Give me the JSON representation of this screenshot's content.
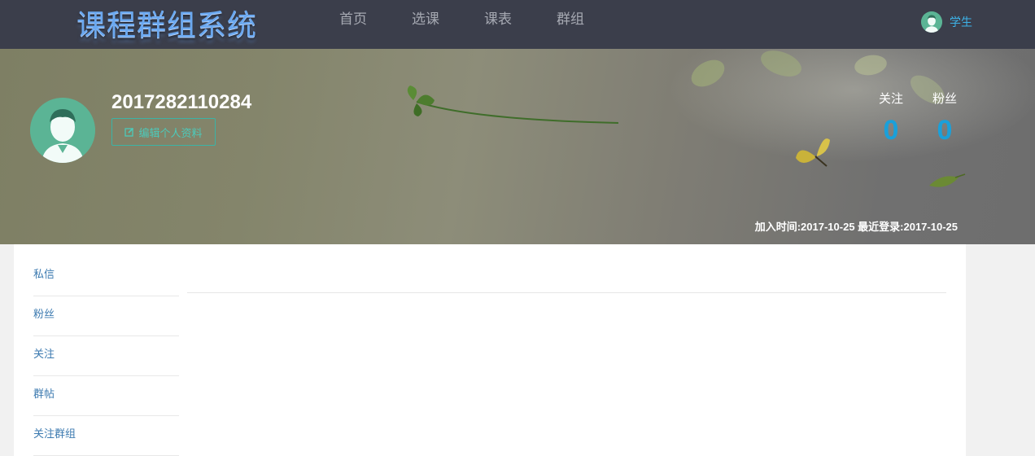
{
  "header": {
    "logo": "课程群组系统",
    "nav": [
      "首页",
      "选课",
      "课表",
      "群组"
    ],
    "user_label": "学生"
  },
  "profile": {
    "student_id": "2017282110284",
    "edit_button": "编辑个人资料",
    "following_label": "关注",
    "following_count": "0",
    "followers_label": "粉丝",
    "followers_count": "0",
    "dates": "加入时间:2017-10-25 最近登录:2017-10-25"
  },
  "sidebar": {
    "items": [
      "私信",
      "粉丝",
      "关注",
      "群帖",
      "关注群组"
    ]
  },
  "colors": {
    "topbar": "#3b3e4b",
    "accent": "#1aa0da",
    "avatar": "#5bb495",
    "link": "#3c7ab0"
  }
}
